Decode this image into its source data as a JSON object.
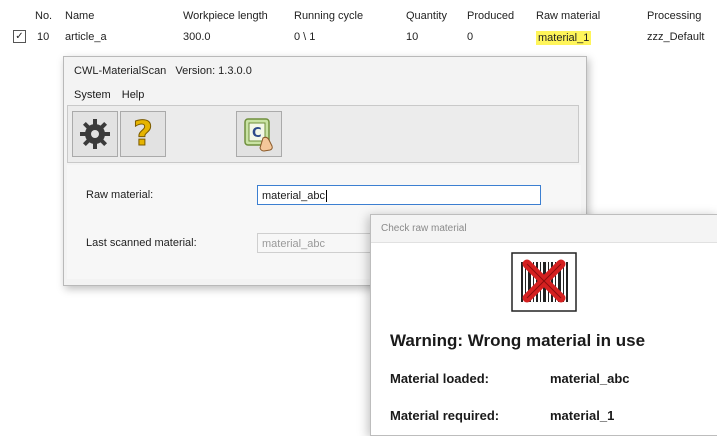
{
  "table": {
    "headers": [
      "No.",
      "Name",
      "Workpiece length",
      "Running cycle",
      "Quantity",
      "Produced",
      "Raw material",
      "Processing"
    ],
    "row": {
      "checked": true,
      "no": "10",
      "name": "article_a",
      "workpiece_length": "300.0",
      "running_cycle": "0 \\ 1",
      "quantity": "10",
      "produced": "0",
      "raw_material": "material_1",
      "processing": "zzz_Default"
    },
    "highlight_color": "#fff55a"
  },
  "scan_window": {
    "app_name": "CWL-MaterialScan",
    "version_label": "Version: 1.3.0.0",
    "menu": [
      "System",
      "Help"
    ],
    "toolbar_icons": [
      "gear-icon",
      "question-mark-icon",
      "barcode-scan-icon"
    ],
    "raw_material_label": "Raw material:",
    "raw_material_value": "material_abc",
    "last_scanned_label": "Last scanned material:",
    "last_scanned_value": "material_abc"
  },
  "dialog": {
    "title": "Check raw material",
    "icon": "error-barcode-icon",
    "warning": "Warning: Wrong material in use",
    "loaded_label": "Material loaded:",
    "loaded_value": "material_abc",
    "required_label": "Material required:",
    "required_value": "material_1",
    "error_color": "#d42020"
  }
}
